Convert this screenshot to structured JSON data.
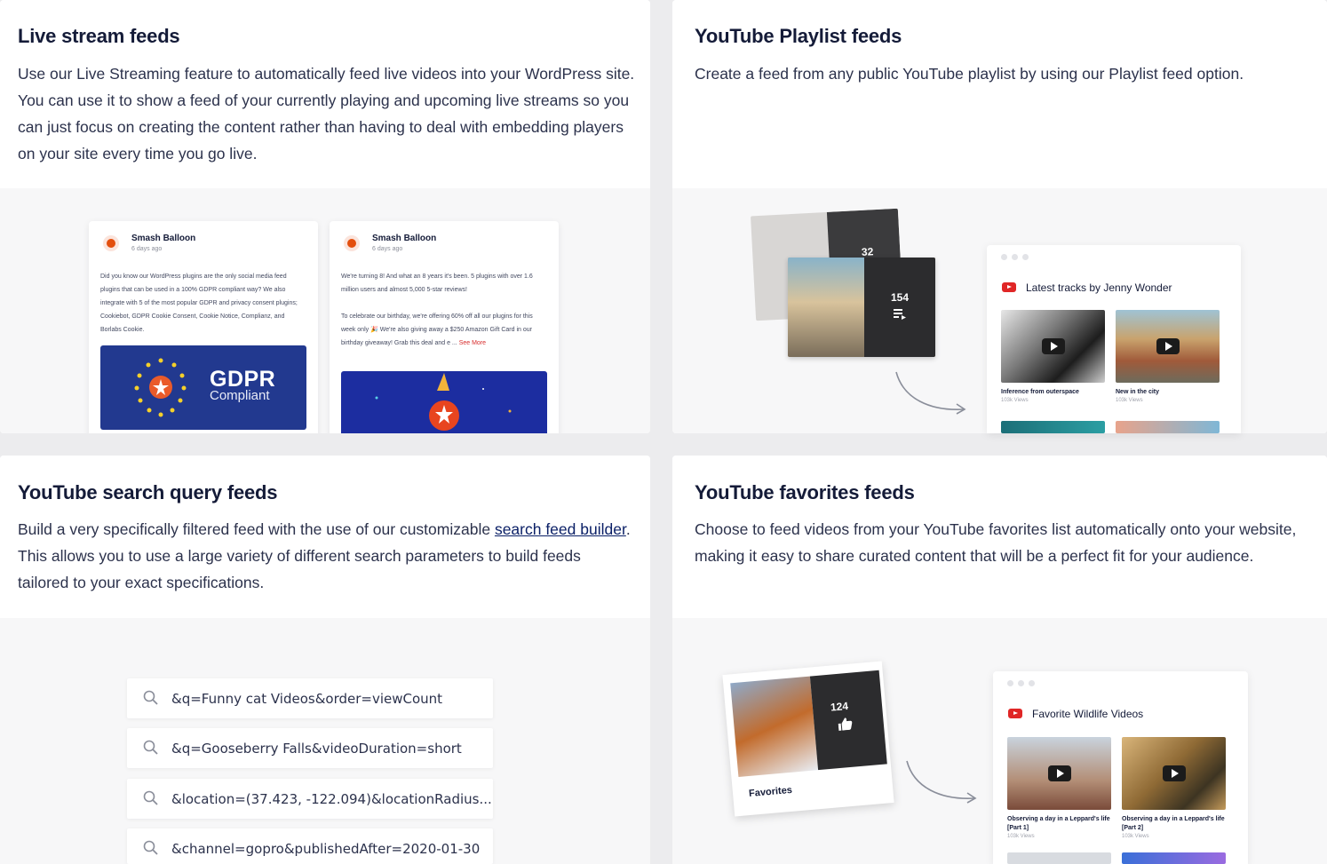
{
  "live": {
    "title": "Live stream feeds",
    "desc": "Use our Live Streaming feature to automatically feed live videos into your WordPress site. You can use it to show a feed of your currently playing and upcoming live streams so you can just focus on creating the content rather than having to deal with embedding players on your site every time you go live.",
    "posts": [
      {
        "name": "Smash Balloon",
        "time": "6 days ago",
        "text": "Did you know our WordPress plugins are the only social media feed plugins that can be used in a 100% GDPR compliant way? We also integrate with 5 of the most popular GDPR and privacy consent plugins; Cookiebot, GDPR Cookie Consent, Cookie Notice, Complianz, and Borlabs Cookie.",
        "image_title": "GDPR",
        "image_sub": "Compliant"
      },
      {
        "name": "Smash Balloon",
        "time": "6 days ago",
        "text1": "We're turning 8! And what an 8 years it's been. 5 plugins with over 1.6 million users and almost 5,000 5-star reviews!",
        "text2": "To celebrate our birthday, we're offering 60% off all our plugins for this week only 🎉 We're also giving away a $250 Amazon Gift Card in our birthday giveaway! Grab this deal and e ...",
        "see_more": "See More"
      }
    ]
  },
  "playlist": {
    "title": "YouTube Playlist feeds",
    "desc": "Create a feed from any public YouTube playlist by using our Playlist feed option.",
    "back_count": "32",
    "front_count": "154",
    "feed_title": "Latest tracks by Jenny Wonder",
    "videos": [
      {
        "caption": "Inference from outerspace",
        "views": "103k Views"
      },
      {
        "caption": "New in the city",
        "views": "103k Views"
      }
    ]
  },
  "search": {
    "title": "YouTube search query feeds",
    "desc_before": "Build a very specifically filtered feed with the use of our customizable ",
    "desc_link": "search feed builder",
    "desc_after": ". This allows you to use a large variety of different search parameters to build feeds tailored to your exact specifications.",
    "queries": [
      "&q=Funny cat Videos&order=viewCount",
      "&q=Gooseberry Falls&videoDuration=short",
      "&location=(37.423, -122.094)&locationRadius...",
      "&channel=gopro&publishedAfter=2020-01-30"
    ]
  },
  "favorites": {
    "title": "YouTube favorites feeds",
    "desc": "Choose to feed videos from your YouTube favorites list automatically onto your website, making it easy to share curated content that will be a perfect fit for your audience.",
    "polaroid_count": "124",
    "polaroid_caption": "Favorites",
    "feed_title": "Favorite Wildlife Videos",
    "videos": [
      {
        "caption": "Observing a day in a Leppard's life [Part 1]",
        "views": "103k Views"
      },
      {
        "caption": "Observing a day in a Leppard's life [Part 2]",
        "views": "103k Views"
      }
    ]
  },
  "colors": {
    "title": "#141b38",
    "body_text": "#2c324c",
    "link": "#0a1f66",
    "youtube_red": "#e02626",
    "panel_bg": "#f7f7f8"
  }
}
